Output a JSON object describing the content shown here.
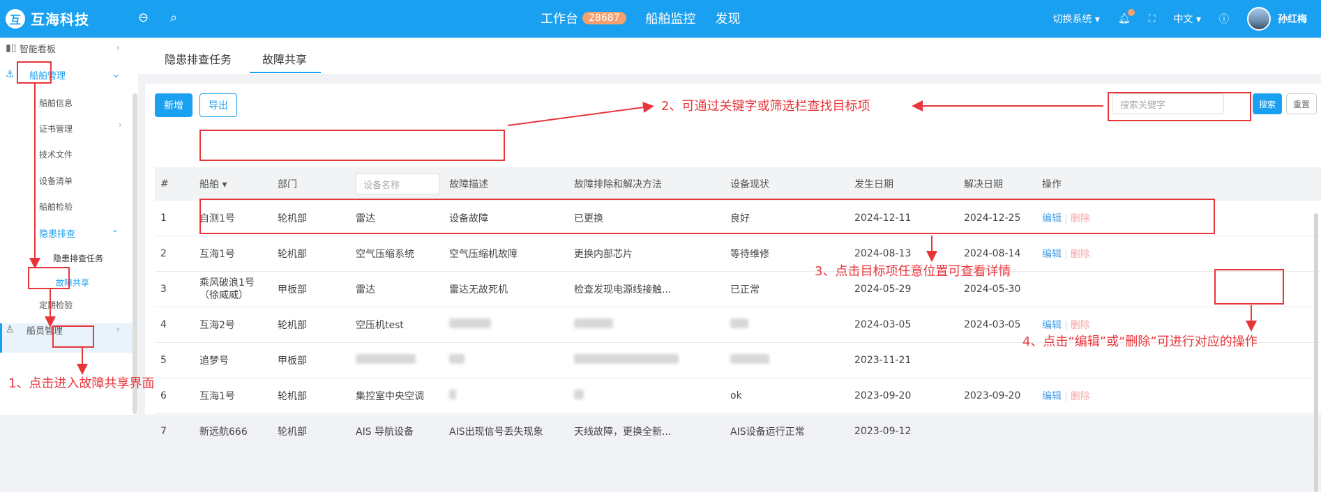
{
  "header": {
    "app_name": "互海科技",
    "nav": [
      {
        "label": "工作台",
        "badge": "28687"
      },
      {
        "label": "船舶监控"
      },
      {
        "label": "发现"
      }
    ],
    "switch_system": "切换系统",
    "language": "中文",
    "user_name": "孙红梅"
  },
  "sidebar": {
    "items": [
      {
        "label": "智能看板"
      },
      {
        "label": "船舶管理"
      },
      {
        "label": "船舶信息"
      },
      {
        "label": "证书管理"
      },
      {
        "label": "技术文件"
      },
      {
        "label": "设备清单"
      },
      {
        "label": "船舶检验"
      },
      {
        "label": "隐患排查"
      },
      {
        "label": "隐患排查任务"
      },
      {
        "label": "故障共享"
      },
      {
        "label": "定期检验"
      },
      {
        "label": "船员管理"
      }
    ]
  },
  "tabs": [
    "隐患排查任务",
    "故障共享"
  ],
  "toolbar": {
    "add_label": "新增",
    "export_label": "导出",
    "search_placeholder": "搜索关键字",
    "search_label": "搜索",
    "reset_label": "重置"
  },
  "table": {
    "headers": {
      "index": "#",
      "ship": "船舶",
      "dept": "部门",
      "device_placeholder": "设备名称",
      "fault_desc": "故障描述",
      "fault_method": "故障排除和解决方法",
      "device_status": "设备现状",
      "occur_date": "发生日期",
      "resolve_date": "解决日期",
      "actions": "操作"
    },
    "edit_label": "编辑",
    "delete_label": "删除",
    "rows": [
      {
        "idx": "1",
        "ship": "自测1号",
        "dept": "轮机部",
        "device": "雷达",
        "desc": "设备故障",
        "method": "已更换",
        "status": "良好",
        "occur": "2024-12-11",
        "resolve": "2024-12-25"
      },
      {
        "idx": "2",
        "ship": "互海1号",
        "dept": "轮机部",
        "device": "空气压缩系统",
        "desc": "空气压缩机故障",
        "method": "更换内部芯片",
        "status": "等待维修",
        "occur": "2024-08-13",
        "resolve": "2024-08-14"
      },
      {
        "idx": "3",
        "ship": "乘风破浪1号（徐威威）",
        "dept": "甲板部",
        "device": "雷达",
        "desc": "雷达无故死机",
        "method": "检查发现电源线接触...",
        "status": "已正常",
        "occur": "2024-05-29",
        "resolve": "2024-05-30"
      },
      {
        "idx": "4",
        "ship": "互海2号",
        "dept": "轮机部",
        "device": "空压机test",
        "desc": "",
        "method": "",
        "status": "",
        "occur": "2024-03-05",
        "resolve": "2024-03-05"
      },
      {
        "idx": "5",
        "ship": "追梦号",
        "dept": "甲板部",
        "device": "",
        "desc": "",
        "method": "",
        "status": "",
        "occur": "2023-11-21",
        "resolve": ""
      },
      {
        "idx": "6",
        "ship": "互海1号",
        "dept": "轮机部",
        "device": "集控室中央空调",
        "desc": "",
        "method": "",
        "status": "ok",
        "occur": "2023-09-20",
        "resolve": "2023-09-20"
      },
      {
        "idx": "7",
        "ship": "新远航666",
        "dept": "轮机部",
        "device": "AIS 导航设备",
        "desc": "AIS出现信号丢失现象",
        "method": "天线故障，更换全新...",
        "status": "AIS设备运行正常",
        "occur": "2023-09-12",
        "resolve": ""
      }
    ]
  },
  "annotations": {
    "a1": "1、点击进入故障共享界面",
    "a2": "2、可通过关键字或筛选栏查找目标项",
    "a3": "3、点击目标项任意位置可查看详情",
    "a4": "4、点击“编辑”或“删除”可进行对应的操作"
  },
  "colors": {
    "primary": "#1aa0f0",
    "annotation": "#e8353a"
  }
}
